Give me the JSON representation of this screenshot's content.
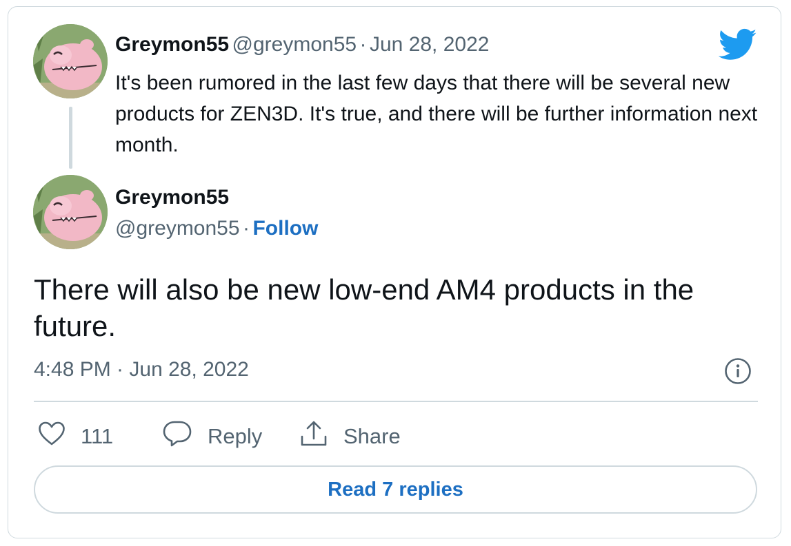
{
  "quoted_tweet": {
    "display_name": "Greymon55",
    "handle": "@greymon55",
    "separator": "·",
    "date": "Jun 28, 2022",
    "text": "It's been rumored in the last few days that there will be several new products for ZEN3D. It's true, and there will be further information next month."
  },
  "tweet": {
    "display_name": "Greymon55",
    "handle": "@greymon55",
    "separator": "·",
    "follow_label": "Follow",
    "text": "There will also be new low-end AM4 products in the future.",
    "time": "4:48 PM · Jun 28, 2022"
  },
  "actions": {
    "like_count": "111",
    "reply_label": "Reply",
    "share_label": "Share"
  },
  "read_replies_label": "Read 7 replies",
  "icons": {
    "brand": "twitter-bird-icon",
    "info": "info-icon",
    "like": "heart-icon",
    "reply": "speech-bubble-icon",
    "share": "share-upload-icon"
  },
  "colors": {
    "twitter_blue": "#1d9bf0",
    "link_blue": "#1d6fc2",
    "secondary_text": "#536471",
    "border": "#cfd9de"
  }
}
